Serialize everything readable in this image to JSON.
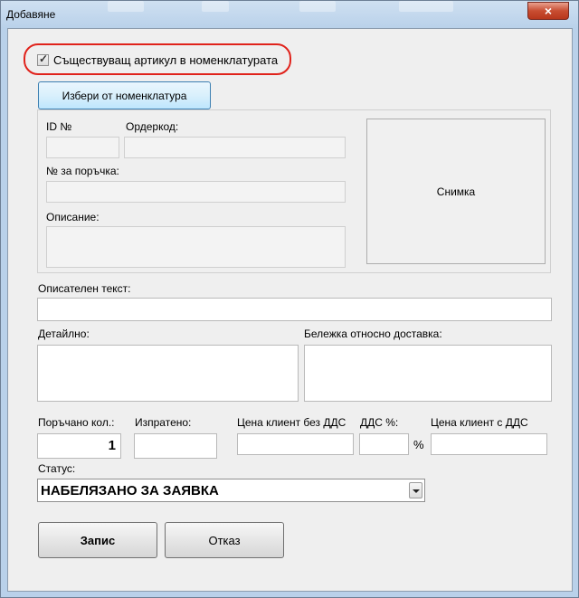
{
  "window": {
    "title": "Добавяне",
    "close_glyph": "×"
  },
  "existing_article_label": "Съществуващ артикул в номенклатурата",
  "existing_article_checked": true,
  "select_button_label": "Избери от номенклатура",
  "fields": {
    "id_label": "ID №",
    "barcode_label": "Ордеркод:",
    "order_no_label": "№ за поръчка:",
    "description_label": "Описание:",
    "descriptive_text_label": "Описателен текст:",
    "detailed_label": "Детайлно:",
    "delivery_note_label": "Бележка относно доставка:",
    "ordered_qty_label": "Поръчано кол.:",
    "ordered_qty_value": "1",
    "sent_label": "Изпратено:",
    "price_no_vat_label": "Цена клиент без ДДС",
    "vat_label": "ДДС %:",
    "percent_sign": "%",
    "price_vat_label": "Цена клиент с ДДС",
    "status_label": "Статус:",
    "status_value": "НАБЕЛЯЗАНО ЗА ЗАЯВКА"
  },
  "photo_label": "Снимка",
  "buttons": {
    "save": "Запис",
    "cancel": "Отказ"
  },
  "colors": {
    "highlight_ring": "#e0221b",
    "close_button": "#c84d32"
  }
}
